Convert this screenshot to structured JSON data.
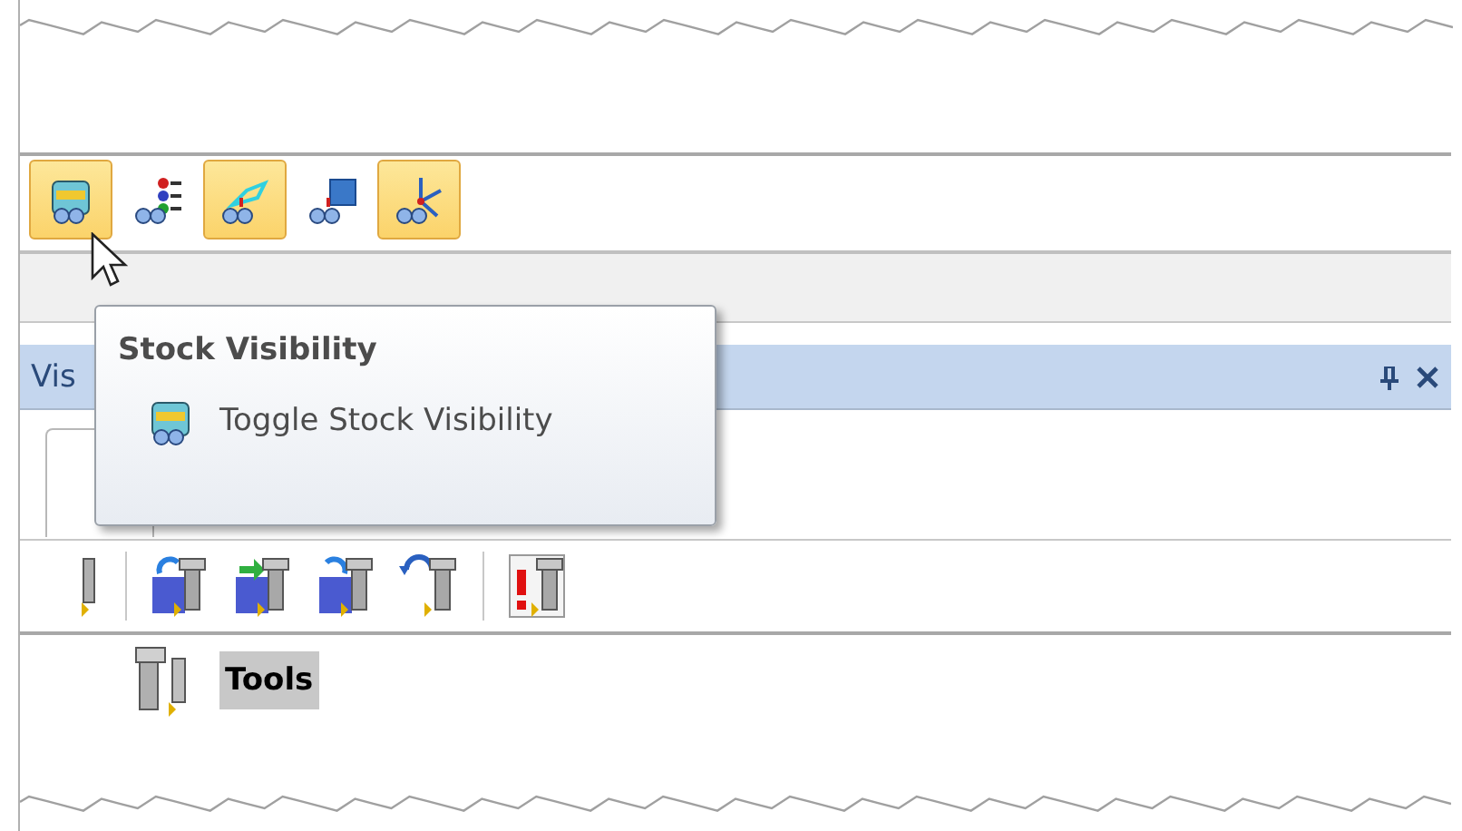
{
  "toolbar": {
    "buttons": [
      {
        "on": true
      },
      {
        "on": false
      },
      {
        "on": true
      },
      {
        "on": false
      },
      {
        "on": true
      }
    ]
  },
  "panel": {
    "title": "Vis"
  },
  "tree": {
    "items": [
      {
        "label": "Tools",
        "selected": true
      }
    ]
  },
  "tooltip": {
    "title": "Stock Visibility",
    "item": "Toggle Stock Visibility"
  }
}
